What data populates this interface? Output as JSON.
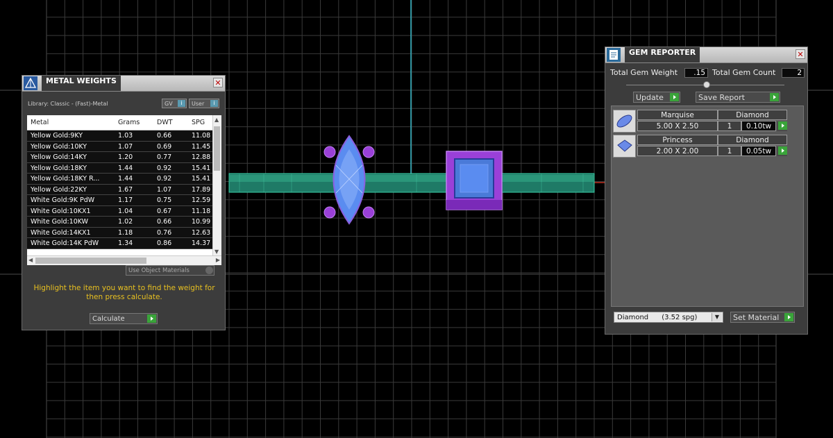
{
  "metal_weights": {
    "title": "METAL WEIGHTS",
    "library": "Library: Classic - (Fast)-Metal",
    "toggle_gv": "GV",
    "toggle_user": "User",
    "toggle_icon": "i",
    "columns": [
      "Metal",
      "Grams",
      "DWT",
      "SPG"
    ],
    "rows": [
      [
        "Yellow Gold:9KY",
        "1.03",
        "0.66",
        "11.08"
      ],
      [
        "Yellow Gold:10KY",
        "1.07",
        "0.69",
        "11.45"
      ],
      [
        "Yellow Gold:14KY",
        "1.20",
        "0.77",
        "12.88"
      ],
      [
        "Yellow Gold:18KY",
        "1.44",
        "0.92",
        "15.41"
      ],
      [
        "Yellow Gold:18KY R...",
        "1.44",
        "0.92",
        "15.41"
      ],
      [
        "Yellow Gold:22KY",
        "1.67",
        "1.07",
        "17.89"
      ],
      [
        "White Gold:9K PdW",
        "1.17",
        "0.75",
        "12.59"
      ],
      [
        "White Gold:10KX1",
        "1.04",
        "0.67",
        "11.18"
      ],
      [
        "White Gold:10KW",
        "1.02",
        "0.66",
        "10.99"
      ],
      [
        "White Gold:14KX1",
        "1.18",
        "0.76",
        "12.63"
      ],
      [
        "White Gold:14K PdW",
        "1.34",
        "0.86",
        "14.37"
      ]
    ],
    "use_object_materials": "Use Object Materials",
    "hint": "Highlight the item you want to find the weight for then press calculate.",
    "calculate_label": "Calculate"
  },
  "gem_reporter": {
    "title": "GEM REPORTER",
    "total_weight_label": "Total Gem Weight",
    "total_weight_value": ".15",
    "total_count_label": "Total Gem Count",
    "total_count_value": "2",
    "update_label": "Update",
    "save_report_label": "Save Report",
    "gems": [
      {
        "cut": "Marquise",
        "material": "Diamond",
        "size": "5.00 X 2.50",
        "qty": "1",
        "weight": "0.10tw"
      },
      {
        "cut": "Princess",
        "material": "Diamond",
        "size": "2.00 X 2.00",
        "qty": "1",
        "weight": "0.05tw"
      }
    ],
    "material_select": "Diamond      (3.52 spg)",
    "set_material_label": "Set Material"
  },
  "colors": {
    "grid": "#5a5a5a",
    "shank": "#2e9e80",
    "gem_blue": "#5a8cf0",
    "prong_purple": "#9a40d8",
    "axis_cyan": "#33b8c8",
    "hint_yellow": "#e8c020",
    "go_green": "#3aa43a"
  },
  "icons": [
    "pyramid-icon",
    "gem-reporter-icon",
    "close-icon",
    "marquise-gem-icon",
    "princess-gem-icon",
    "play-arrow-icon"
  ]
}
